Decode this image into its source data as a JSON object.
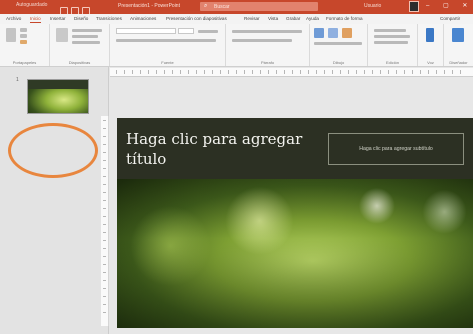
{
  "titlebar": {
    "autosave_label": "Autoguardado",
    "doc_title": "Presentación1 - PowerPoint",
    "search_placeholder": "Buscar",
    "user_name": "Usuario",
    "window_buttons": "–  ▢  ✕"
  },
  "tabs": [
    "Archivo",
    "Inicio",
    "Insertar",
    "Diseño",
    "Transiciones",
    "Animaciones",
    "Presentación con diapositivas",
    "Revisar",
    "Vista",
    "Grabar",
    "Ayuda",
    "Formato de forma",
    "Compartir"
  ],
  "ribbon": {
    "groups": [
      "Portapapeles",
      "Diapositivas",
      "Fuente",
      "Párrafo",
      "Dibujo",
      "Edición",
      "Voz",
      "Diseñador"
    ]
  },
  "thumbnails": [
    {
      "number": "1"
    }
  ],
  "slide": {
    "title_line1": "Haga clic para agregar",
    "title_line2": "título",
    "subtitle": "Haga clic para agregar subtítulo"
  },
  "colors": {
    "accent": "#c7472b",
    "highlight_ring": "#e8863e",
    "title_band": "#2c3023"
  }
}
